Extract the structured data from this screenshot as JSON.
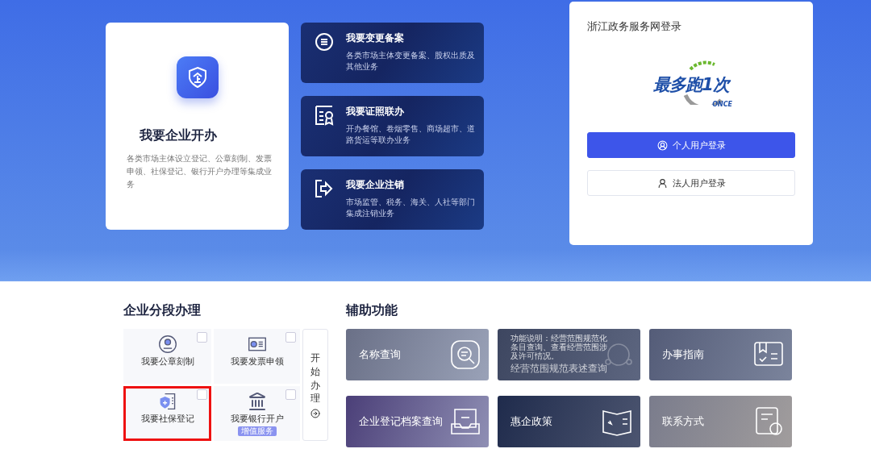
{
  "start_card": {
    "title": "我要企业开办",
    "description": "各类市场主体设立登记、公章刻制、发票申领、社保登记、银行开户办理等集成业务"
  },
  "service_cards": [
    {
      "kind": "change",
      "title": "我要变更备案",
      "description": "各类市场主体变更备案、股权出质及其他业务"
    },
    {
      "kind": "license",
      "title": "我要证照联办",
      "description": "开办餐馆、卷烟零售、商场超市、道路货运等联办业务"
    },
    {
      "kind": "cancel",
      "title": "我要企业注销",
      "description": "市场监管、税务、海关、人社等部门集成注销业务"
    }
  ],
  "login": {
    "title": "浙江政务服务网登录",
    "logo_text": "最多跑1次",
    "logo_sub": "ONCE",
    "buttons": [
      {
        "kind": "primary",
        "label": "个人用户登录"
      },
      {
        "kind": "secondary",
        "label": "法人用户登录"
      }
    ]
  },
  "stages": {
    "title": "企业分段办理",
    "items": [
      {
        "kind": "seal",
        "label": "我要公章刻制",
        "checked": false,
        "highlighted": false
      },
      {
        "kind": "invoice",
        "label": "我要发票申领",
        "checked": false,
        "highlighted": false
      },
      {
        "kind": "social",
        "label": "我要社保登记",
        "checked": false,
        "highlighted": true
      },
      {
        "kind": "bank",
        "label": "我要银行开户",
        "checked": false,
        "highlighted": false,
        "badge": "增值服务"
      }
    ],
    "start_button": "开始办理"
  },
  "assist": {
    "title": "辅助功能",
    "tiles": [
      {
        "kind": "search",
        "label": "名称查询"
      },
      {
        "kind": "scope",
        "label": "经营范围规范表述查询",
        "description": "功能说明：经营范围规范化条目查询、查看经营范围涉及许可情况。"
      },
      {
        "kind": "guide",
        "label": "办事指南"
      },
      {
        "kind": "archive",
        "label": "企业登记档案查询"
      },
      {
        "kind": "policy",
        "label": "惠企政策"
      },
      {
        "kind": "contact",
        "label": "联系方式"
      }
    ]
  }
}
